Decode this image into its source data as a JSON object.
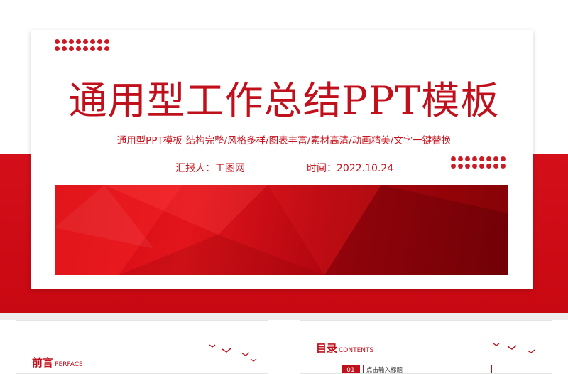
{
  "cover": {
    "title": "通用型工作总结PPT模板",
    "subtitle": "通用型PPT模板-结构完整/风格多样/图表丰富/素材高清/动画精美/文字一键替换",
    "reporter": "汇报人：工图网",
    "date": "时间：2022.10.24"
  },
  "colors": {
    "brand_red": "#c0101c",
    "band_red": "#d40f1a"
  },
  "thumb_left": {
    "title": "前言",
    "subtitle": "PERFACE"
  },
  "thumb_right": {
    "title": "目录",
    "subtitle": "CONTENTS",
    "item_number": "01",
    "item_text": "点击输入标题"
  },
  "icons": [
    "dot-grid-icon",
    "birds-icon"
  ]
}
